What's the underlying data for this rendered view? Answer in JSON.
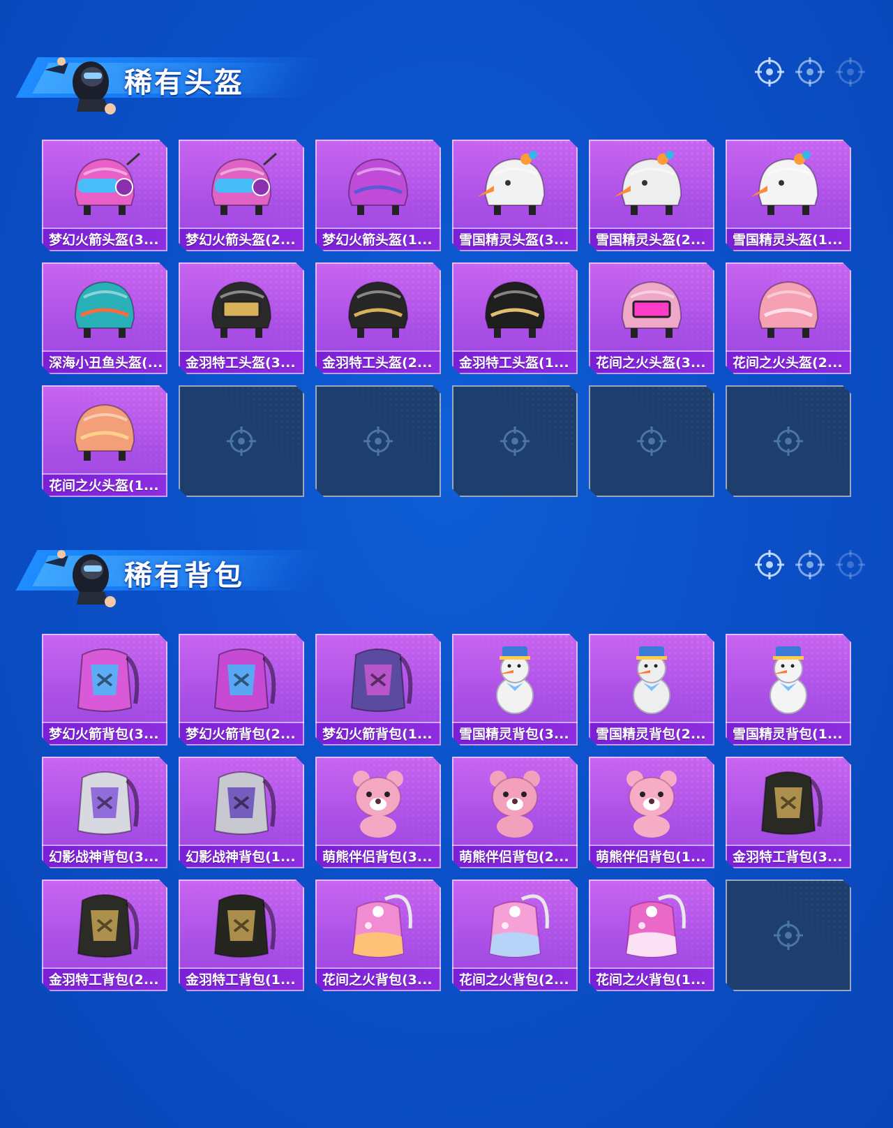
{
  "colors": {
    "background": "#0b50c8",
    "card_purple": "#b35aeb",
    "card_label": "#7a1fd6",
    "card_empty": "#1e3f6e",
    "text": "#ffffff"
  },
  "sections": [
    {
      "title": "稀有头盔",
      "items": [
        {
          "name": "梦幻火箭头盔(3...",
          "icon": "helmet-icon",
          "art": "rocket",
          "color": "#e85fc8",
          "accent": "#35c8ff"
        },
        {
          "name": "梦幻火箭头盔(2...",
          "icon": "helmet-icon",
          "art": "rocket",
          "color": "#e062c4",
          "accent": "#35c8ff"
        },
        {
          "name": "梦幻火箭头盔(1...",
          "icon": "helmet-icon",
          "art": "open",
          "color": "#c04bd8",
          "accent": "#5a5ad8"
        },
        {
          "name": "雪国精灵头盔(3...",
          "icon": "helmet-icon",
          "art": "snow",
          "color": "#f2f2f2",
          "accent": "#ff8a3a"
        },
        {
          "name": "雪国精灵头盔(2...",
          "icon": "helmet-icon",
          "art": "snow",
          "color": "#eeeeee",
          "accent": "#ff8a3a"
        },
        {
          "name": "雪国精灵头盔(1...",
          "icon": "helmet-icon",
          "art": "snow",
          "color": "#f4f4f4",
          "accent": "#ff8a3a"
        },
        {
          "name": "深海小丑鱼头盔(...",
          "icon": "helmet-icon",
          "art": "open",
          "color": "#2ab0b8",
          "accent": "#ff6a3a"
        },
        {
          "name": "金羽特工头盔(3...",
          "icon": "helmet-icon",
          "art": "visor",
          "color": "#2a2a2a",
          "accent": "#d8b25a"
        },
        {
          "name": "金羽特工头盔(2...",
          "icon": "helmet-icon",
          "art": "open",
          "color": "#262626",
          "accent": "#d8b25a"
        },
        {
          "name": "金羽特工头盔(1...",
          "icon": "helmet-icon",
          "art": "open",
          "color": "#1e1e1e",
          "accent": "#e0c070"
        },
        {
          "name": "花间之火头盔(3...",
          "icon": "helmet-icon",
          "art": "visor",
          "color": "#f0a8c8",
          "accent": "#ff3cc8"
        },
        {
          "name": "花间之火头盔(2...",
          "icon": "helmet-icon",
          "art": "open",
          "color": "#f6a0b4",
          "accent": "#ffe0ea"
        },
        {
          "name": "花间之火头盔(1...",
          "icon": "helmet-icon",
          "art": "open",
          "color": "#f3a07a",
          "accent": "#ffd08a"
        }
      ],
      "empty_count": 5
    },
    {
      "title": "稀有背包",
      "items": [
        {
          "name": "梦幻火箭背包(3...",
          "icon": "backpack-icon",
          "art": "pack",
          "color": "#d85ad8",
          "accent": "#35c8ff"
        },
        {
          "name": "梦幻火箭背包(2...",
          "icon": "backpack-icon",
          "art": "pack",
          "color": "#c64ad4",
          "accent": "#35c8ff"
        },
        {
          "name": "梦幻火箭背包(1...",
          "icon": "backpack-icon",
          "art": "pack",
          "color": "#5a4aa0",
          "accent": "#d85ad8"
        },
        {
          "name": "雪国精灵背包(3...",
          "icon": "backpack-icon",
          "art": "snowman",
          "color": "#f2f2f2",
          "accent": "#3a7ad8"
        },
        {
          "name": "雪国精灵背包(2...",
          "icon": "backpack-icon",
          "art": "snowman",
          "color": "#eeeeee",
          "accent": "#3a7ad8"
        },
        {
          "name": "雪国精灵背包(1...",
          "icon": "backpack-icon",
          "art": "snowman",
          "color": "#f4f4f4",
          "accent": "#3a7ad8"
        },
        {
          "name": "幻影战神背包(3...",
          "icon": "backpack-icon",
          "art": "pack",
          "color": "#d8d8e0",
          "accent": "#7a4ad8"
        },
        {
          "name": "幻影战神背包(1...",
          "icon": "backpack-icon",
          "art": "pack",
          "color": "#c8c8d0",
          "accent": "#5a3ab8"
        },
        {
          "name": "萌熊伴侣背包(3...",
          "icon": "backpack-icon",
          "art": "bear",
          "color": "#f4a8c4",
          "accent": "#ffffff"
        },
        {
          "name": "萌熊伴侣背包(2...",
          "icon": "backpack-icon",
          "art": "bear",
          "color": "#f2a0bc",
          "accent": "#ffffff"
        },
        {
          "name": "萌熊伴侣背包(1...",
          "icon": "backpack-icon",
          "art": "bear",
          "color": "#f6acc4",
          "accent": "#ffffff"
        },
        {
          "name": "金羽特工背包(3...",
          "icon": "backpack-icon",
          "art": "pack",
          "color": "#2a2a24",
          "accent": "#d8b25a"
        },
        {
          "name": "金羽特工背包(2...",
          "icon": "backpack-icon",
          "art": "pack",
          "color": "#2c2c26",
          "accent": "#d8b25a"
        },
        {
          "name": "金羽特工背包(1...",
          "icon": "backpack-icon",
          "art": "pack",
          "color": "#262620",
          "accent": "#d8b25a"
        },
        {
          "name": "花间之火背包(3...",
          "icon": "backpack-icon",
          "art": "flower",
          "color": "#f28cd2",
          "accent": "#ffd060"
        },
        {
          "name": "花间之火背包(2...",
          "icon": "backpack-icon",
          "art": "flower",
          "color": "#f6a0d8",
          "accent": "#a8e0ff"
        },
        {
          "name": "花间之火背包(1...",
          "icon": "backpack-icon",
          "art": "flower",
          "color": "#ea68c8",
          "accent": "#ffffff"
        }
      ],
      "empty_count": 1
    }
  ]
}
